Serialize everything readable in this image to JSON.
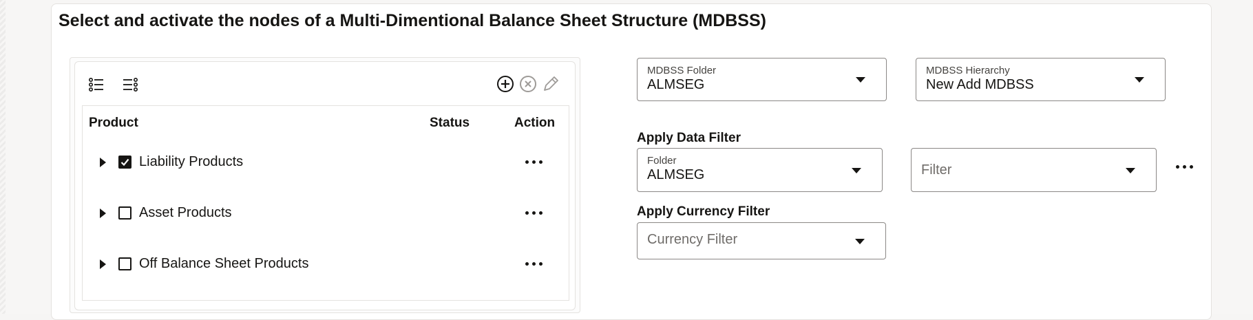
{
  "page": {
    "title": "Select and activate the nodes of a Multi-Dimentional Balance Sheet Structure (MDBSS)"
  },
  "tree": {
    "toolbar": {
      "expand_all_icon": "list-expand-icon",
      "collapse_all_icon": "list-collapse-icon",
      "add_icon": "add-circle-icon",
      "remove_icon": "remove-circle-icon",
      "edit_icon": "pencil-icon"
    },
    "columns": {
      "product": "Product",
      "status": "Status",
      "action": "Action"
    },
    "rows": [
      {
        "label": "Liability Products",
        "checked": true
      },
      {
        "label": "Asset Products",
        "checked": false
      },
      {
        "label": "Off Balance Sheet Products",
        "checked": false
      }
    ]
  },
  "mdbss_folder": {
    "label": "MDBSS Folder",
    "value": "ALMSEG"
  },
  "mdbss_hierarchy": {
    "label": "MDBSS Hierarchy",
    "value": "New Add MDBSS"
  },
  "data_filter": {
    "section_label": "Apply Data Filter",
    "folder": {
      "label": "Folder",
      "value": "ALMSEG"
    },
    "filter": {
      "placeholder": "Filter"
    }
  },
  "currency_filter": {
    "section_label": "Apply Currency Filter",
    "placeholder": "Currency Filter"
  },
  "colors": {
    "text": "#161513",
    "border": "#8a8785",
    "panel_border": "#e4e2df"
  }
}
